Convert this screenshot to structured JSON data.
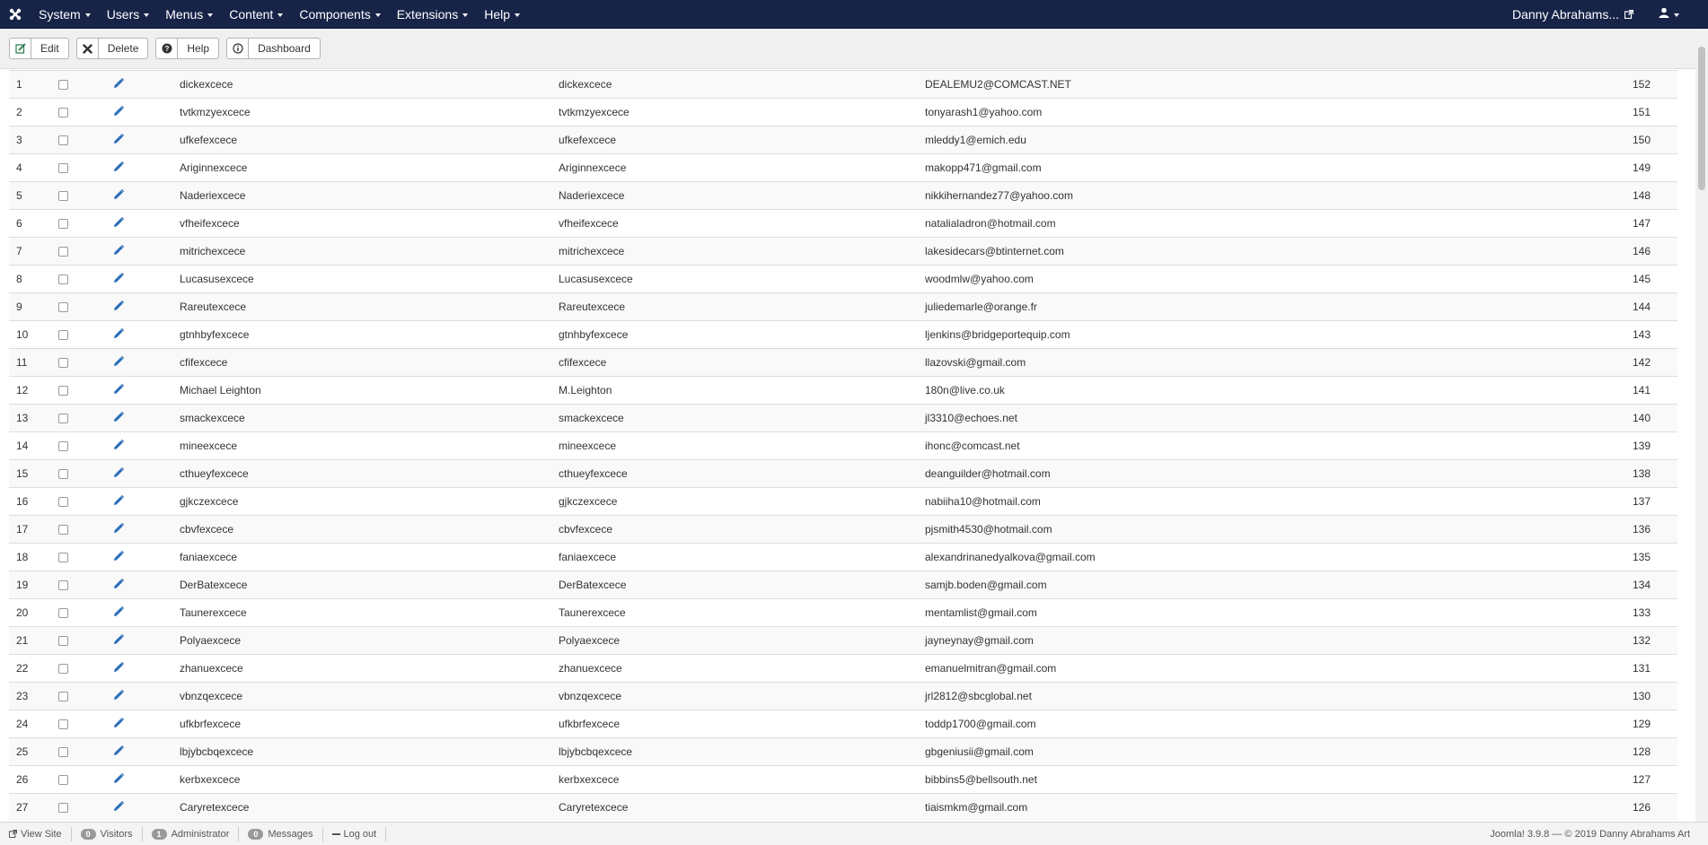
{
  "navbar": {
    "brand_icon": "joomla-logo-icon",
    "menus": [
      {
        "label": "System"
      },
      {
        "label": "Users"
      },
      {
        "label": "Menus"
      },
      {
        "label": "Content"
      },
      {
        "label": "Components"
      },
      {
        "label": "Extensions"
      },
      {
        "label": "Help"
      }
    ],
    "user_name": "Danny Abrahams...",
    "background": "#172448"
  },
  "toolbar": {
    "edit_label": "Edit",
    "delete_label": "Delete",
    "help_label": "Help",
    "dashboard_label": "Dashboard"
  },
  "table": {
    "rows": [
      {
        "num": "1",
        "name": "dickexcece",
        "username": "dickexcece",
        "email": "DEALEMU2@COMCAST.NET",
        "id": "152"
      },
      {
        "num": "2",
        "name": "tvtkmzyexcece",
        "username": "tvtkmzyexcece",
        "email": "tonyarash1@yahoo.com",
        "id": "151"
      },
      {
        "num": "3",
        "name": "ufkefexcece",
        "username": "ufkefexcece",
        "email": "mleddy1@emich.edu",
        "id": "150"
      },
      {
        "num": "4",
        "name": "Ariginnexcece",
        "username": "Ariginnexcece",
        "email": "makopp471@gmail.com",
        "id": "149"
      },
      {
        "num": "5",
        "name": "Naderiexcece",
        "username": "Naderiexcece",
        "email": "nikkihernandez77@yahoo.com",
        "id": "148"
      },
      {
        "num": "6",
        "name": "vfheifexcece",
        "username": "vfheifexcece",
        "email": "natalialadron@hotmail.com",
        "id": "147"
      },
      {
        "num": "7",
        "name": "mitrichexcece",
        "username": "mitrichexcece",
        "email": "lakesidecars@btinternet.com",
        "id": "146"
      },
      {
        "num": "8",
        "name": "Lucasusexcece",
        "username": "Lucasusexcece",
        "email": "woodmlw@yahoo.com",
        "id": "145"
      },
      {
        "num": "9",
        "name": "Rareutexcece",
        "username": "Rareutexcece",
        "email": "juliedemarle@orange.fr",
        "id": "144"
      },
      {
        "num": "10",
        "name": "gtnhbyfexcece",
        "username": "gtnhbyfexcece",
        "email": "ljenkins@bridgeportequip.com",
        "id": "143"
      },
      {
        "num": "11",
        "name": "cfifexcece",
        "username": "cfifexcece",
        "email": "llazovski@gmail.com",
        "id": "142"
      },
      {
        "num": "12",
        "name": "Michael Leighton",
        "username": "M.Leighton",
        "email": "180n@live.co.uk",
        "id": "141"
      },
      {
        "num": "13",
        "name": "smackexcece",
        "username": "smackexcece",
        "email": "jl3310@echoes.net",
        "id": "140"
      },
      {
        "num": "14",
        "name": "mineexcece",
        "username": "mineexcece",
        "email": "ihonc@comcast.net",
        "id": "139"
      },
      {
        "num": "15",
        "name": "cthueyfexcece",
        "username": "cthueyfexcece",
        "email": "deanguilder@hotmail.com",
        "id": "138"
      },
      {
        "num": "16",
        "name": "gjkczexcece",
        "username": "gjkczexcece",
        "email": "nabiiha10@hotmail.com",
        "id": "137"
      },
      {
        "num": "17",
        "name": "cbvfexcece",
        "username": "cbvfexcece",
        "email": "pjsmith4530@hotmail.com",
        "id": "136"
      },
      {
        "num": "18",
        "name": "faniaexcece",
        "username": "faniaexcece",
        "email": "alexandrinanedyalkova@gmail.com",
        "id": "135"
      },
      {
        "num": "19",
        "name": "DerBatexcece",
        "username": "DerBatexcece",
        "email": "samjb.boden@gmail.com",
        "id": "134"
      },
      {
        "num": "20",
        "name": "Taunerexcece",
        "username": "Taunerexcece",
        "email": "mentamlist@gmail.com",
        "id": "133"
      },
      {
        "num": "21",
        "name": "Polyaexcece",
        "username": "Polyaexcece",
        "email": "jayneynay@gmail.com",
        "id": "132"
      },
      {
        "num": "22",
        "name": "zhanuexcece",
        "username": "zhanuexcece",
        "email": "emanuelmitran@gmail.com",
        "id": "131"
      },
      {
        "num": "23",
        "name": "vbnzqexcece",
        "username": "vbnzqexcece",
        "email": "jrl2812@sbcglobal.net",
        "id": "130"
      },
      {
        "num": "24",
        "name": "ufkbrfexcece",
        "username": "ufkbrfexcece",
        "email": "toddp1700@gmail.com",
        "id": "129"
      },
      {
        "num": "25",
        "name": "lbjybcbqexcece",
        "username": "lbjybcbqexcece",
        "email": "gbgeniusii@gmail.com",
        "id": "128"
      },
      {
        "num": "26",
        "name": "kerbxexcece",
        "username": "kerbxexcece",
        "email": "bibbins5@bellsouth.net",
        "id": "127"
      },
      {
        "num": "27",
        "name": "Caryretexcece",
        "username": "Caryretexcece",
        "email": "tiaismkm@gmail.com",
        "id": "126"
      }
    ]
  },
  "statusbar": {
    "view_site": "View Site",
    "visitors_count": "0",
    "visitors_label": "Visitors",
    "admin_count": "1",
    "admin_label": "Administrator",
    "messages_count": "0",
    "messages_label": "Messages",
    "logout_label": "Log out",
    "version": "Joomla! 3.9.8",
    "copyright": "© 2019 Danny Abrahams Art"
  },
  "colors": {
    "navbar": "#172448",
    "edit_icon": "#2a6ebb",
    "row_stripe": "#f9f9f9"
  }
}
